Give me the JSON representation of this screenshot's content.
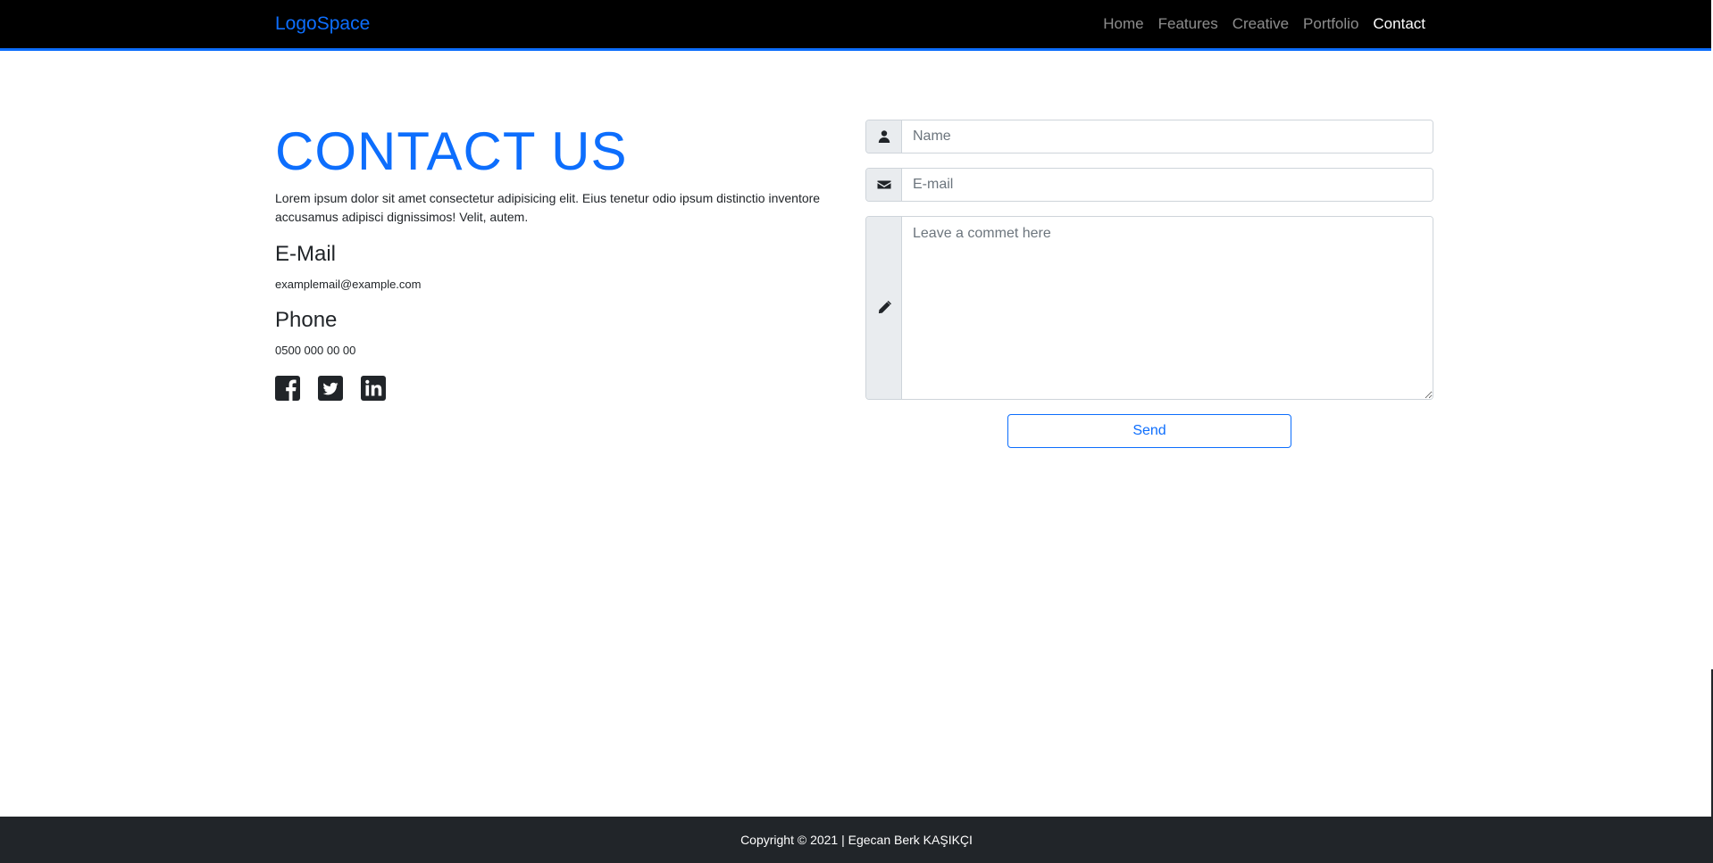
{
  "nav": {
    "brand": "LogoSpace",
    "links": [
      {
        "label": "Home",
        "active": false
      },
      {
        "label": "Features",
        "active": false
      },
      {
        "label": "Creative",
        "active": false
      },
      {
        "label": "Portfolio",
        "active": false
      },
      {
        "label": "Contact",
        "active": true
      }
    ]
  },
  "contact": {
    "title": "CONTACT US",
    "description": "Lorem ipsum dolor sit amet consectetur adipisicing elit. Eius tenetur odio ipsum distinctio inventore accusamus adipisci dignissimos! Velit, autem.",
    "email_heading": "E-Mail",
    "email_value": "examplemail@example.com",
    "phone_heading": "Phone",
    "phone_value": "0500 000 00 00",
    "socials": [
      "facebook-icon",
      "twitter-icon",
      "linkedin-icon"
    ]
  },
  "form": {
    "name_placeholder": "Name",
    "email_placeholder": "E-mail",
    "comment_placeholder": "Leave a commet here",
    "send_label": "Send",
    "icons": [
      "user-icon",
      "envelope-icon",
      "pencil-icon"
    ]
  },
  "footer": {
    "text": "Copyright © 2021 | Egecan Berk KAŞIKÇI"
  },
  "colors": {
    "accent": "#0d6efd",
    "navbar_bg": "#000000",
    "footer_bg": "#212529",
    "addon_bg": "#e9ecef"
  }
}
